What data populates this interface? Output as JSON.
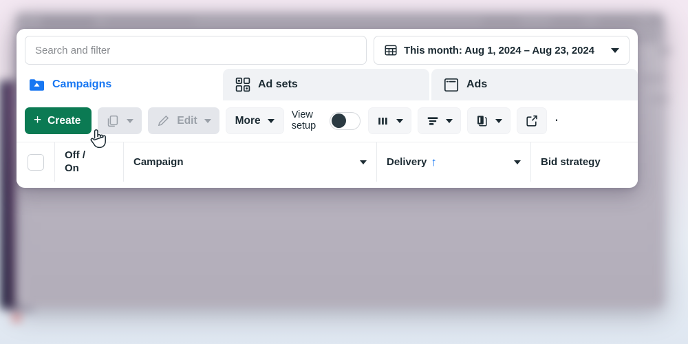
{
  "search": {
    "placeholder": "Search and filter",
    "value": ""
  },
  "date_range": {
    "icon": "calendar-icon",
    "label": "This month: Aug 1, 2024 – Aug 23, 2024",
    "caret": "chevron-down-icon"
  },
  "tabs": [
    {
      "id": "campaigns",
      "label": "Campaigns",
      "icon": "campaign-folder-icon",
      "active": true
    },
    {
      "id": "adsets",
      "label": "Ad sets",
      "icon": "adsets-grid-icon",
      "active": false
    },
    {
      "id": "ads",
      "label": "Ads",
      "icon": "ads-window-icon",
      "active": false
    }
  ],
  "toolbar": {
    "create_label": "Create",
    "create_plus": "+",
    "duplicate_icon": "duplicate-icon",
    "edit_label": "Edit",
    "edit_icon": "pencil-icon",
    "more_label": "More",
    "view_setup_line1": "View",
    "view_setup_line2": "setup",
    "view_setup_on": false,
    "columns_icon": "columns-icon",
    "breakdown_icon": "breakdown-icon",
    "reports_icon": "reports-icon",
    "export_icon": "export-icon",
    "overflow_label": "⋯"
  },
  "table": {
    "columns": [
      {
        "id": "select",
        "label": "",
        "icon": "checkbox-icon"
      },
      {
        "id": "offon",
        "label_line1": "Off /",
        "label_line2": "On"
      },
      {
        "id": "campaign",
        "label": "Campaign",
        "caret": true
      },
      {
        "id": "delivery",
        "label": "Delivery",
        "sort": "↑",
        "caret": true
      },
      {
        "id": "bid",
        "label": "Bid strategy",
        "caret": false
      }
    ]
  },
  "colors": {
    "create_green": "#0b7a53",
    "active_tab_blue": "#1877f2",
    "sort_arrow_blue": "#1877f2",
    "disabled_button_bg": "#e4e6eb",
    "page_background": "#f1e7f0"
  },
  "cursor": {
    "type": "pointer-hand-cursor"
  }
}
